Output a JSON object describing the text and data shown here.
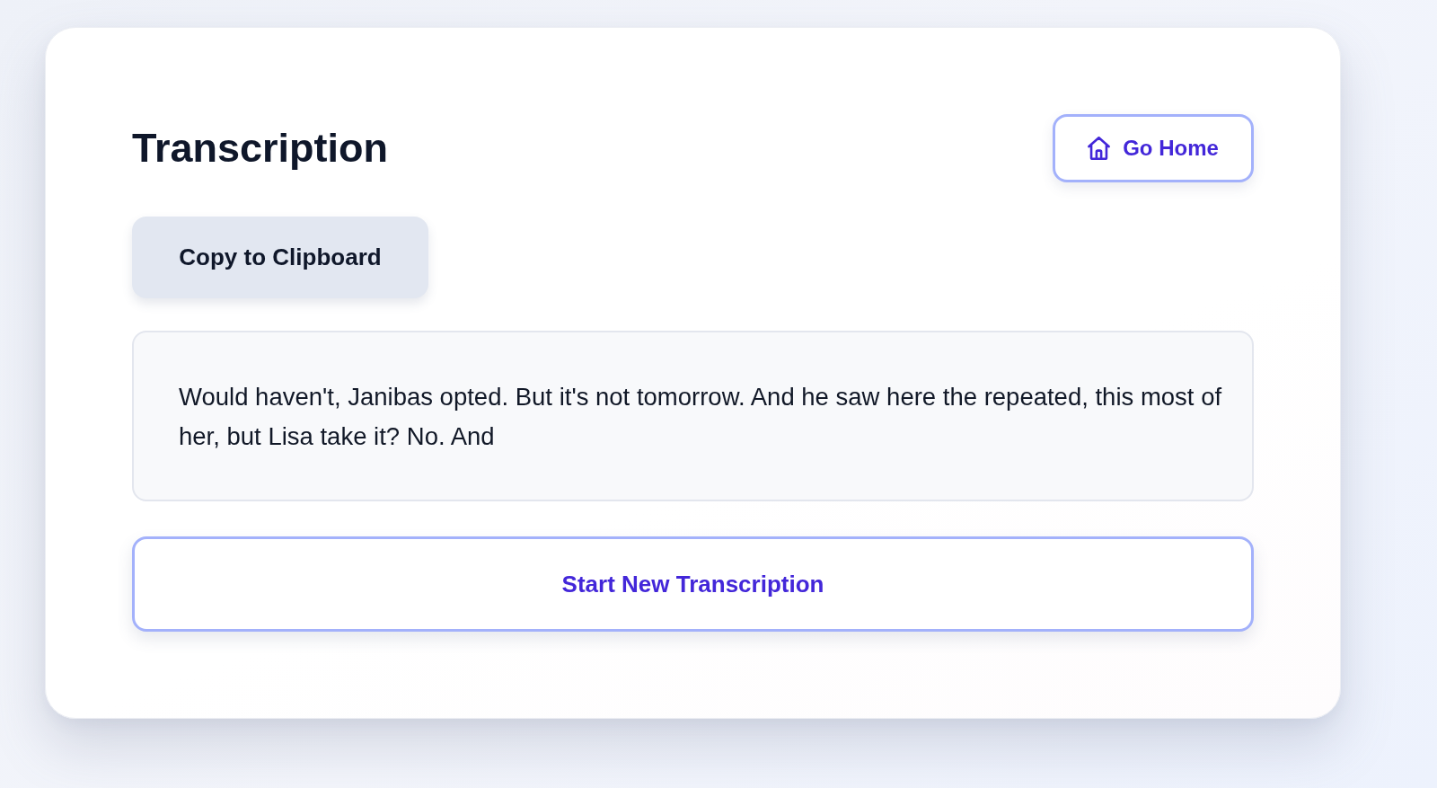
{
  "header": {
    "title": "Transcription",
    "home_button": {
      "label": "Go Home"
    }
  },
  "copy_button": {
    "label": "Copy to Clipboard"
  },
  "transcript": {
    "text": "Would haven't, Janibas opted. But it's not tomorrow. And he saw here the repeated, this most of her, but Lisa take it? No. And"
  },
  "new_button": {
    "label": "Start New Transcription"
  }
}
